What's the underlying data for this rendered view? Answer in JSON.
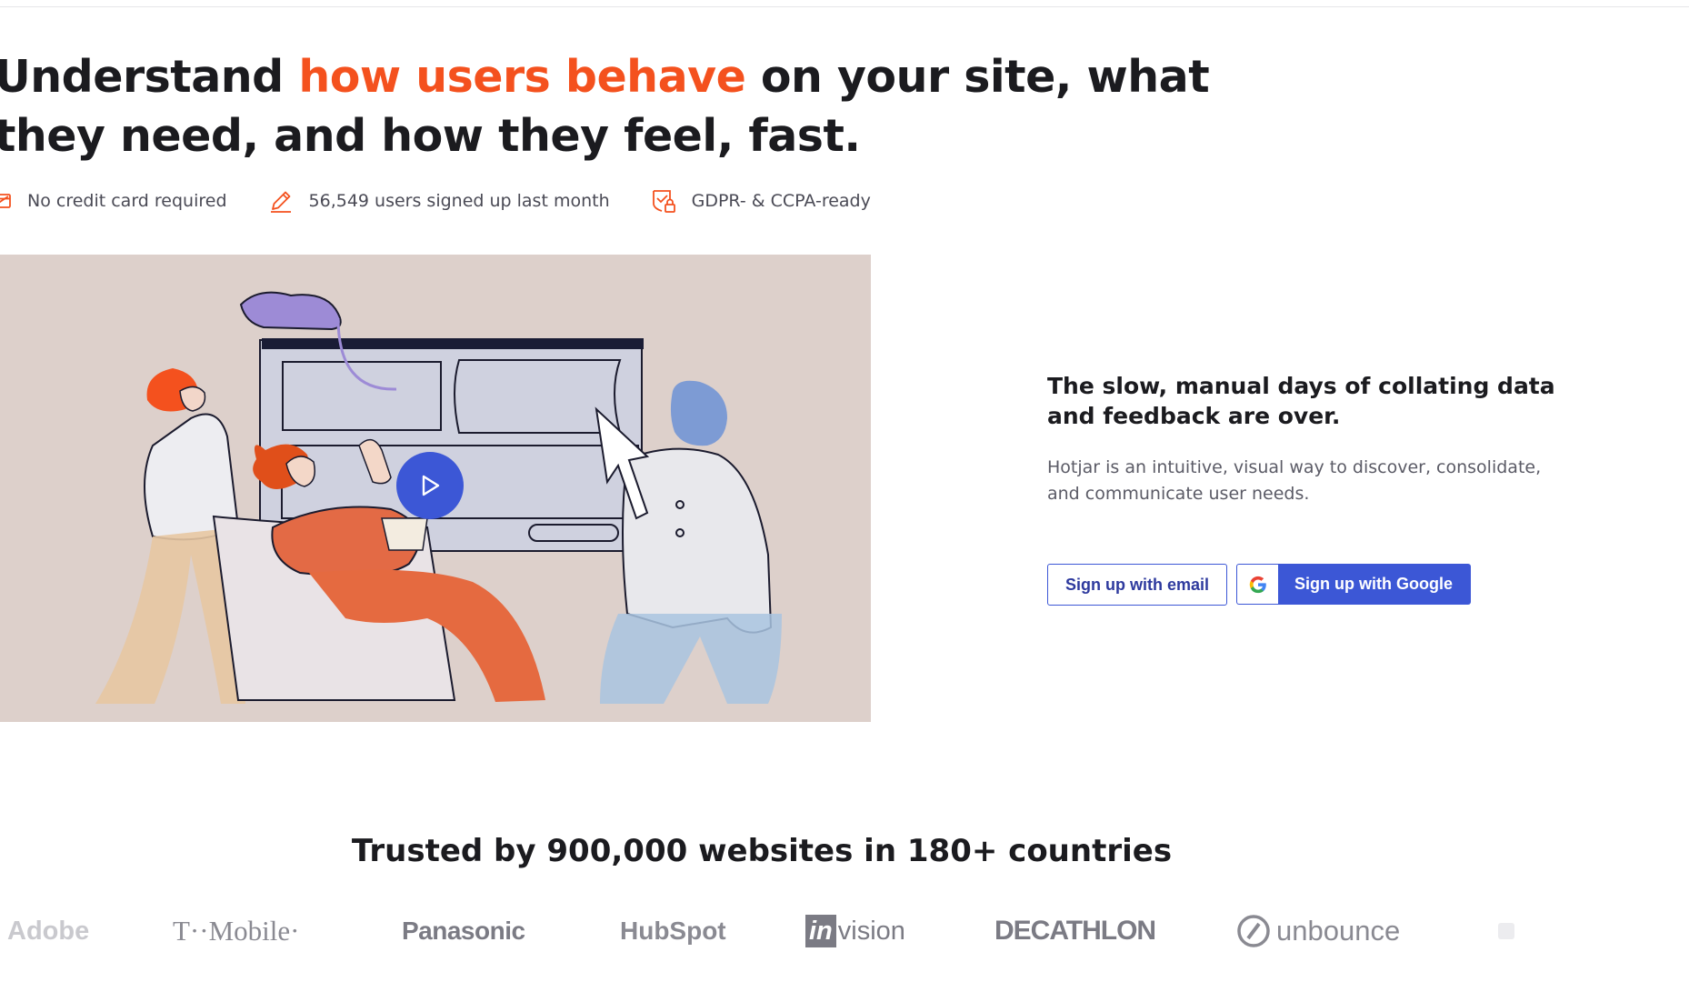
{
  "hero": {
    "headline_before": "Understand ",
    "headline_accent": "how users behave",
    "headline_after": " on your site, what they need, and how they feel, fast.",
    "accent_color": "#f4511e"
  },
  "benefits": [
    {
      "icon": "credit-card-icon",
      "label": "No credit card required"
    },
    {
      "icon": "pencil-icon",
      "label": "56,549 users signed up last month"
    },
    {
      "icon": "shield-check-icon",
      "label": "GDPR- & CCPA-ready"
    }
  ],
  "video": {
    "play_icon": "play-icon",
    "background": "#ddd0cb",
    "play_color": "#3c57d6"
  },
  "promo": {
    "title": "The slow, manual days of collating data and feedback are over.",
    "text": "Hotjar is an intuitive, visual way to discover, consolidate, and communicate user needs.",
    "email_button": "Sign up with email",
    "google_button": "Sign up with Google",
    "google_icon": "google-icon",
    "button_color": "#3c57d6"
  },
  "trusted": {
    "heading": "Trusted by 900,000 websites in 180+ countries",
    "logos": [
      "Adobe",
      "T··Mobile·",
      "Panasonic",
      "HubSpot",
      "InVision",
      "DECATHLON",
      "unbounce"
    ]
  }
}
